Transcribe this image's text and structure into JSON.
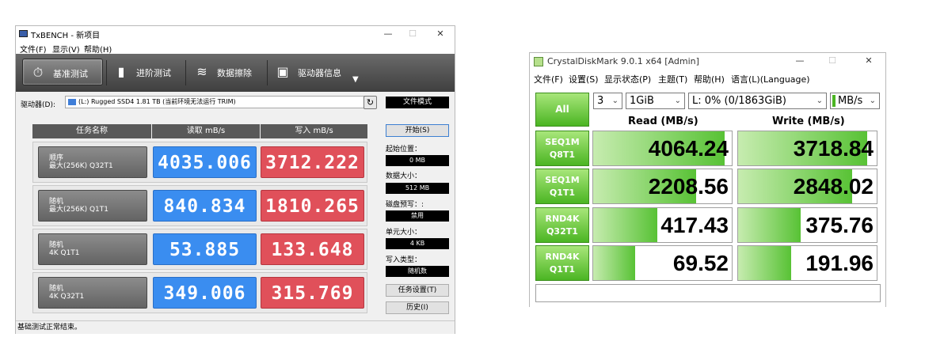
{
  "txbench": {
    "title": "TxBENCH - 新项目",
    "window_controls": {
      "minimize": "—",
      "maximize": "☐",
      "close": "✕"
    },
    "menu": [
      "文件(F)",
      "显示(V)",
      "帮助(H)"
    ],
    "toolbar": [
      {
        "label": "基准测试",
        "icon": "stopwatch-icon",
        "glyph": "⏱",
        "active": true
      },
      {
        "label": "进阶测试",
        "icon": "bar-chart-icon",
        "glyph": "▮",
        "active": false
      },
      {
        "label": "数据擦除",
        "icon": "eraser-icon",
        "glyph": "≋",
        "active": false
      },
      {
        "label": "驱动器信息",
        "icon": "drive-info-icon",
        "glyph": "▣",
        "active": false
      }
    ],
    "toolbar_more": "▼",
    "drive_label": "驱动器(D):",
    "drive_value": "(L:) Rugged SSD4  1.81 TB (当前环境无法运行 TRIM)",
    "refresh_glyph": "↻",
    "mode_button": "文件模式",
    "headers": {
      "name": "任务名称",
      "read": "读取 mB/s",
      "write": "写入 mB/s"
    },
    "rows": [
      {
        "line1": "顺序",
        "line2": "最大(256K) Q32T1",
        "read": "4035.006",
        "write": "3712.222"
      },
      {
        "line1": "随机",
        "line2": "最大(256K) Q1T1",
        "read": "840.834",
        "write": "1810.265"
      },
      {
        "line1": "随机",
        "line2": "4K Q1T1",
        "read": "53.885",
        "write": "133.648"
      },
      {
        "line1": "随机",
        "line2": "4K Q32T1",
        "read": "349.006",
        "write": "315.769"
      }
    ],
    "start_button": "开始(S)",
    "start_pos_label": "起始位置：",
    "start_pos_value": "0 MB",
    "data_size_label": "数据大小：",
    "data_size_value": "512 MB",
    "preconditioning_label": "磁盘预写：:",
    "preconditioning_value": "禁用",
    "unit_size_label": "单元大小：",
    "unit_size_value": "4 KB",
    "write_type_label": "写入类型：",
    "write_type_value": "随机数",
    "task_settings_button": "任务设置(T)",
    "history_button": "历史(I)",
    "status": "基础测试正常结束。"
  },
  "cdm": {
    "title": "CrystalDiskMark 9.0.1 x64 [Admin]",
    "window_controls": {
      "minimize": "—",
      "maximize": "☐",
      "close": "✕"
    },
    "menu": [
      "文件(F)",
      "设置(S)",
      "显示状态(P)",
      "主题(T)",
      "帮助(H)",
      "语言(L)(Language)"
    ],
    "all_button": "All",
    "count": "3",
    "size": "1GiB",
    "drive": "L: 0% (0/1863GiB)",
    "unit": "MB/s",
    "read_header": "Read (MB/s)",
    "write_header": "Write (MB/s)",
    "accent": "#4bb523",
    "rows": [
      {
        "line1": "SEQ1M",
        "line2": "Q8T1",
        "read": "4064.24",
        "write": "3718.84",
        "read_fill": 0.95,
        "write_fill": 0.93
      },
      {
        "line1": "SEQ1M",
        "line2": "Q1T1",
        "read": "2208.56",
        "write": "2848.02",
        "read_fill": 0.74,
        "write_fill": 0.82
      },
      {
        "line1": "RND4K",
        "line2": "Q32T1",
        "read": "417.43",
        "write": "375.76",
        "read_fill": 0.46,
        "write_fill": 0.45
      },
      {
        "line1": "RND4K",
        "line2": "Q1T1",
        "read": "69.52",
        "write": "191.96",
        "read_fill": 0.3,
        "write_fill": 0.38
      }
    ],
    "comment": ""
  }
}
